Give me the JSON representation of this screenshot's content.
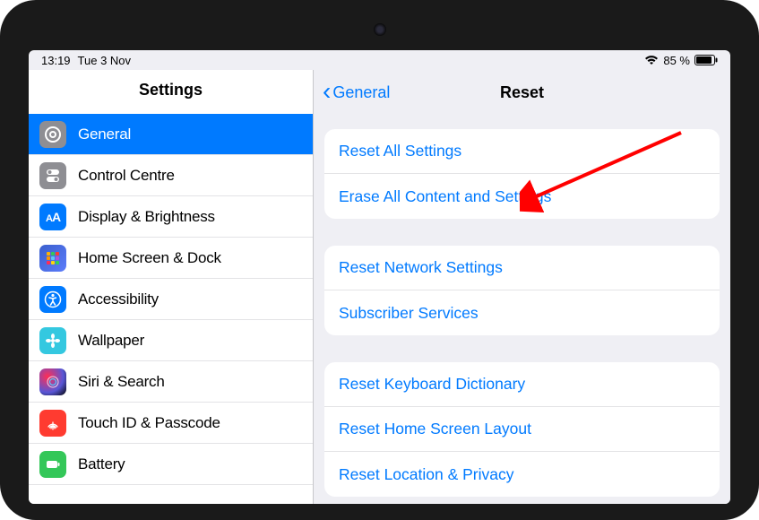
{
  "status": {
    "time": "13:19",
    "date": "Tue 3 Nov",
    "battery_pct": "85 %"
  },
  "sidebar": {
    "title": "Settings",
    "items": [
      {
        "label": "General"
      },
      {
        "label": "Control Centre"
      },
      {
        "label": "Display & Brightness"
      },
      {
        "label": "Home Screen & Dock"
      },
      {
        "label": "Accessibility"
      },
      {
        "label": "Wallpaper"
      },
      {
        "label": "Siri & Search"
      },
      {
        "label": "Touch ID & Passcode"
      },
      {
        "label": "Battery"
      }
    ]
  },
  "detail": {
    "back_label": "General",
    "title": "Reset",
    "groups": [
      {
        "rows": [
          {
            "label": "Reset All Settings"
          },
          {
            "label": "Erase All Content and Settings"
          }
        ]
      },
      {
        "rows": [
          {
            "label": "Reset Network Settings"
          },
          {
            "label": "Subscriber Services"
          }
        ]
      },
      {
        "rows": [
          {
            "label": "Reset Keyboard Dictionary"
          },
          {
            "label": "Reset Home Screen Layout"
          },
          {
            "label": "Reset Location & Privacy"
          }
        ]
      }
    ]
  }
}
